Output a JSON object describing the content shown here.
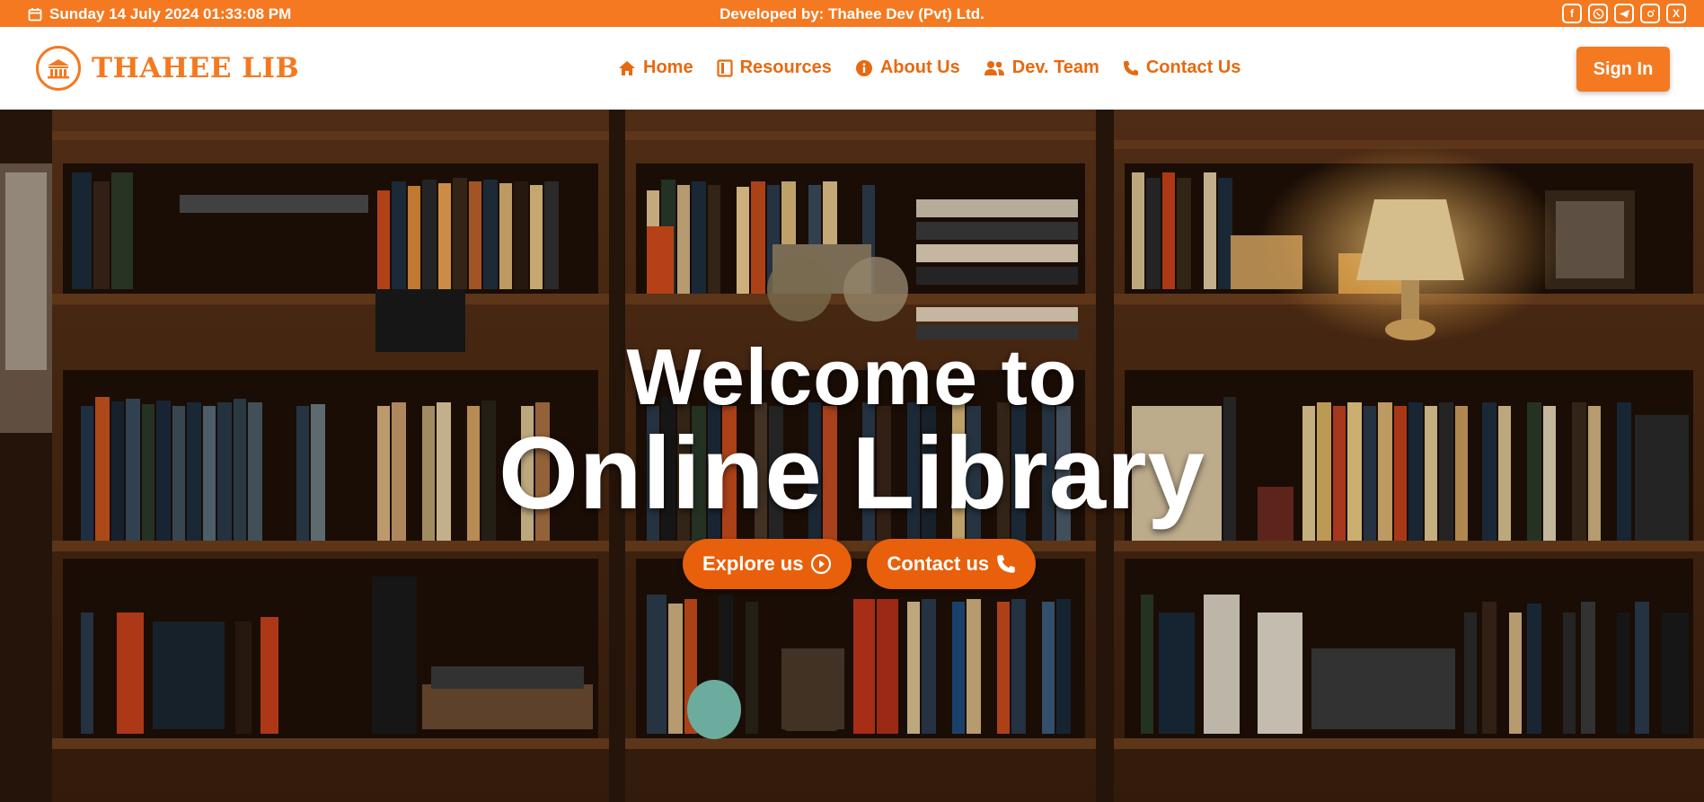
{
  "topbar": {
    "datetime": "Sunday 14 July 2024 01:33:08 PM",
    "developer": "Developed by: Thahee Dev (Pvt) Ltd.",
    "socials": [
      "facebook-icon",
      "whatsapp-icon",
      "telegram-icon",
      "instagram-icon",
      "x-icon"
    ],
    "bg_color": "#f47920"
  },
  "navbar": {
    "logo_text": "THAHEE LIB",
    "items": [
      {
        "label": "Home",
        "icon": "home-icon"
      },
      {
        "label": "Resources",
        "icon": "book-icon"
      },
      {
        "label": "About Us",
        "icon": "info-icon"
      },
      {
        "label": "Dev. Team",
        "icon": "users-icon"
      },
      {
        "label": "Contact Us",
        "icon": "phone-icon"
      }
    ],
    "signin_label": "Sign In",
    "accent_color": "#f47920"
  },
  "hero": {
    "title_line1": "Welcome to",
    "title_line2": "Online Library",
    "explore_label": "Explore us",
    "contact_label": "Contact us",
    "button_color": "#e8600c"
  }
}
